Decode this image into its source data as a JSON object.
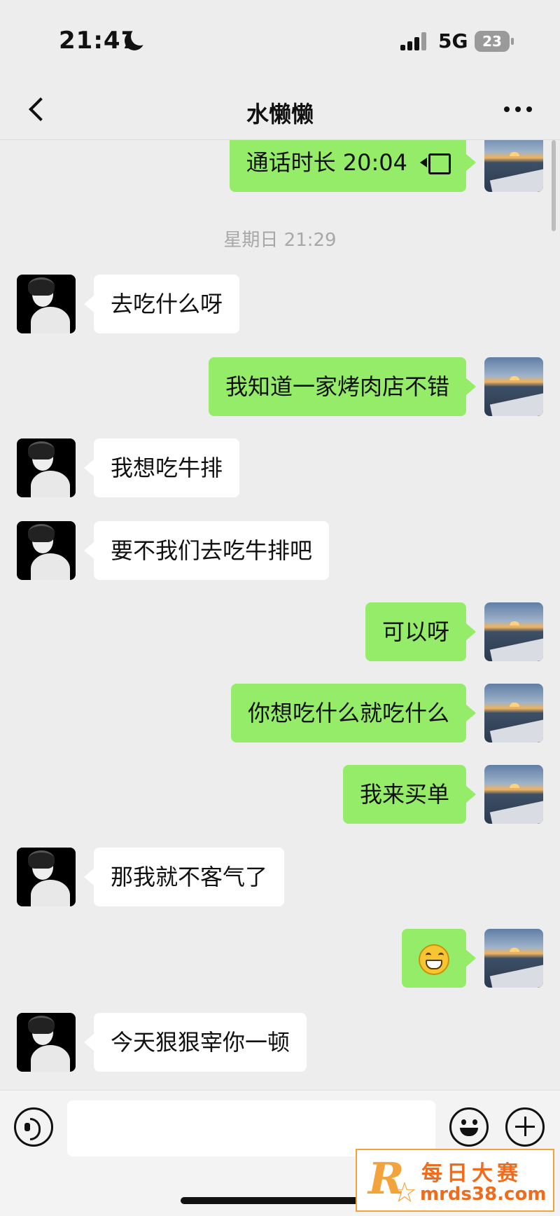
{
  "status_bar": {
    "time": "21:47",
    "network": "5G",
    "battery": "23"
  },
  "header": {
    "title": "水懒懒"
  },
  "messages": [
    {
      "side": "out",
      "text": "通话时长 20:04",
      "type": "call"
    },
    {
      "side": "meta",
      "text": "星期日 21:29"
    },
    {
      "side": "in",
      "text": "去吃什么呀"
    },
    {
      "side": "out",
      "text": "我知道一家烤肉店不错"
    },
    {
      "side": "in",
      "text": "我想吃牛排"
    },
    {
      "side": "in",
      "text": "要不我们去吃牛排吧"
    },
    {
      "side": "out",
      "text": "可以呀"
    },
    {
      "side": "out",
      "text": "你想吃什么就吃什么"
    },
    {
      "side": "out",
      "text": "我来买单"
    },
    {
      "side": "in",
      "text": "那我就不客气了"
    },
    {
      "side": "out",
      "text": "",
      "type": "emoji",
      "emoji": "grinning-face-icon"
    },
    {
      "side": "in",
      "text": "今天狠狠宰你一顿"
    }
  ],
  "input_bar": {
    "placeholder": ""
  },
  "watermark": {
    "brand_cn": "每日大赛",
    "url": "mrds38.com",
    "logo_letter": "R"
  },
  "colors": {
    "sent_bubble": "#95ec69",
    "received_bubble": "#ffffff",
    "background": "#ededed"
  }
}
